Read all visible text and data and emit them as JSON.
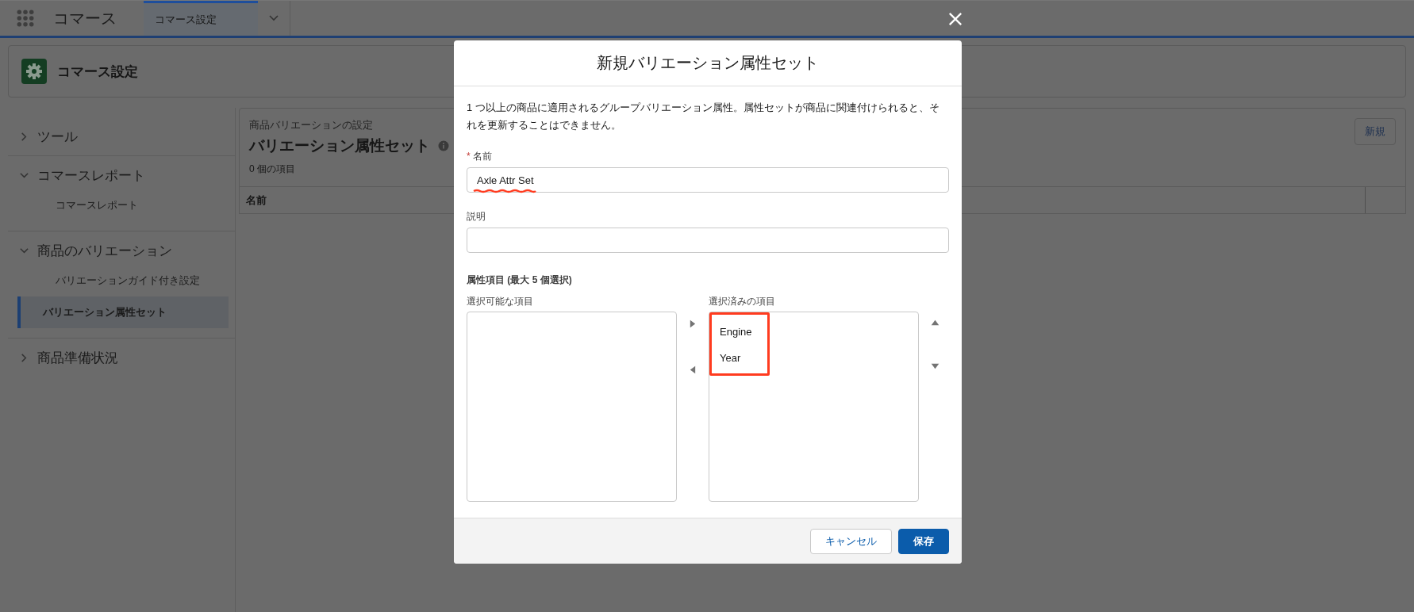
{
  "app": {
    "name": "コマース"
  },
  "tabs": [
    {
      "label": "コマース設定",
      "selected": true
    }
  ],
  "page_header": {
    "title": "コマース設定"
  },
  "sidebar": {
    "sections": [
      {
        "label": "ツール",
        "expanded": false
      },
      {
        "label": "コマースレポート",
        "expanded": true,
        "children": [
          {
            "label": "コマースレポート",
            "selected": false
          }
        ]
      },
      {
        "label": "商品のバリエーション",
        "expanded": true,
        "children": [
          {
            "label": "バリエーションガイド付き設定",
            "selected": false
          },
          {
            "label": "バリエーション属性セット",
            "selected": true
          }
        ]
      },
      {
        "label": "商品準備状況",
        "expanded": false
      }
    ]
  },
  "list_view": {
    "breadcrumb": "商品バリエーションの設定",
    "title": "バリエーション属性セット",
    "count": "0 個の項目",
    "new_button": "新規",
    "columns": [
      "名前"
    ]
  },
  "modal": {
    "title": "新規バリエーション属性セット",
    "description": "1 つ以上の商品に適用されるグループバリエーション属性。属性セットが商品に関連付けられると、それを更新することはできません。",
    "fields": [
      {
        "label": "名前",
        "required_mark": "*",
        "value": "Axle Attr Set",
        "annotated": true
      },
      {
        "label": "説明"
      }
    ],
    "dual_list": {
      "label": "属性項目 (最大 5 個選択)",
      "available_label": "選択可能な項目",
      "selected_label": "選択済みの項目",
      "selected_items": [
        {
          "label": "Engine"
        },
        {
          "label": "Year"
        }
      ],
      "annotated": true
    },
    "buttons": [
      {
        "label": "キャンセル",
        "kind": "neutral"
      },
      {
        "label": "保存",
        "kind": "brand"
      }
    ]
  }
}
